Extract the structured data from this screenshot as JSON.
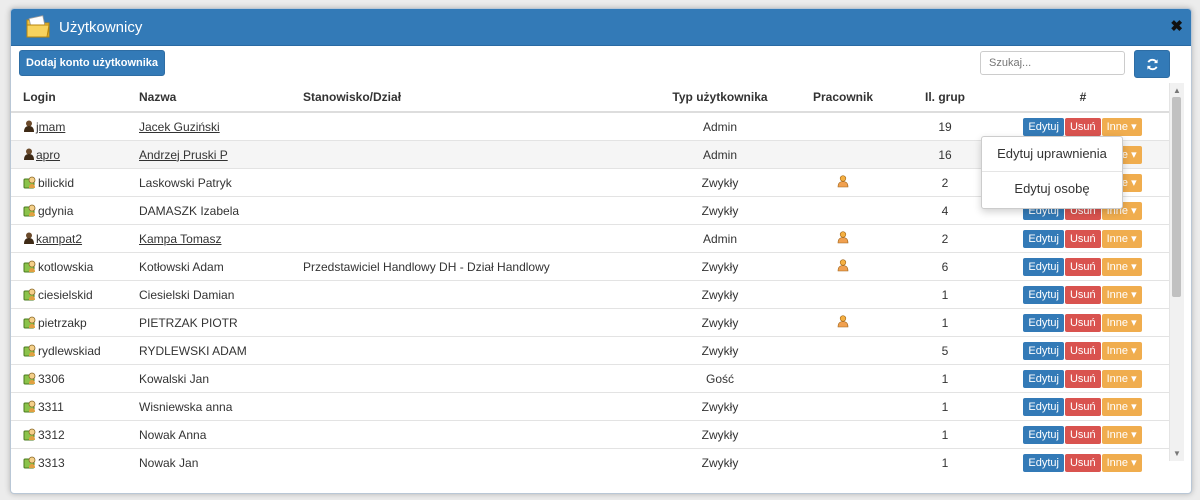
{
  "window": {
    "title": "Użytkownicy",
    "close_label": "✖"
  },
  "toolbar": {
    "add_label": "Dodaj konto użytkownika",
    "search_placeholder": "Szukaj..."
  },
  "table": {
    "headers": [
      "Login",
      "Nazwa",
      "Stanowisko/Dział",
      "Typ użytkownika",
      "Pracownik",
      "Il. grup",
      "#"
    ],
    "rows": [
      {
        "login": "jmam",
        "name": "Jacek Guziński",
        "position": "",
        "type": "Admin",
        "employee": false,
        "groups": "19",
        "admin": true
      },
      {
        "login": "apro",
        "name": "Andrzej Pruski P",
        "position": "",
        "type": "Admin",
        "employee": false,
        "groups": "16",
        "admin": true
      },
      {
        "login": "bilickid",
        "name": "Laskowski Patryk",
        "position": "",
        "type": "Zwykły",
        "employee": true,
        "groups": "2",
        "admin": false
      },
      {
        "login": "gdynia",
        "name": "DAMASZK Izabela",
        "position": "",
        "type": "Zwykły",
        "employee": false,
        "groups": "4",
        "admin": false
      },
      {
        "login": "kampat2",
        "name": "Kampa Tomasz",
        "position": "",
        "type": "Admin",
        "employee": true,
        "groups": "2",
        "admin": true
      },
      {
        "login": "kotlowskia",
        "name": "Kotłowski Adam",
        "position": "Przedstawiciel Handlowy DH - Dział Handlowy",
        "type": "Zwykły",
        "employee": true,
        "groups": "6",
        "admin": false
      },
      {
        "login": "ciesielskid",
        "name": "Ciesielski Damian",
        "position": "",
        "type": "Zwykły",
        "employee": false,
        "groups": "1",
        "admin": false
      },
      {
        "login": "pietrzakp",
        "name": "PIETRZAK PIOTR",
        "position": "",
        "type": "Zwykły",
        "employee": true,
        "groups": "1",
        "admin": false
      },
      {
        "login": "rydlewskiad",
        "name": "RYDLEWSKI ADAM",
        "position": "",
        "type": "Zwykły",
        "employee": false,
        "groups": "5",
        "admin": false
      },
      {
        "login": "3306",
        "name": "Kowalski Jan",
        "position": "",
        "type": "Gość",
        "employee": false,
        "groups": "1",
        "admin": false
      },
      {
        "login": "3311",
        "name": "Wisniewska anna",
        "position": "",
        "type": "Zwykły",
        "employee": false,
        "groups": "1",
        "admin": false
      },
      {
        "login": "3312",
        "name": "Nowak Anna",
        "position": "",
        "type": "Zwykły",
        "employee": false,
        "groups": "1",
        "admin": false
      },
      {
        "login": "3313",
        "name": "Nowak Jan",
        "position": "",
        "type": "Zwykły",
        "employee": false,
        "groups": "1",
        "admin": false
      }
    ],
    "actions": {
      "edit": "Edytuj",
      "delete": "Usuń",
      "other": "Inne ▾"
    }
  },
  "dropdown": {
    "items": [
      "Edytuj uprawnienia",
      "Edytuj osobę"
    ]
  },
  "colors": {
    "primary": "#337ab7",
    "danger": "#d9534f",
    "warning": "#f0ad4e"
  },
  "icons": {
    "admin": "admin-user-icon",
    "user": "user-icon",
    "employee": "employee-icon",
    "refresh": "refresh-icon",
    "folder": "folder-icon"
  }
}
